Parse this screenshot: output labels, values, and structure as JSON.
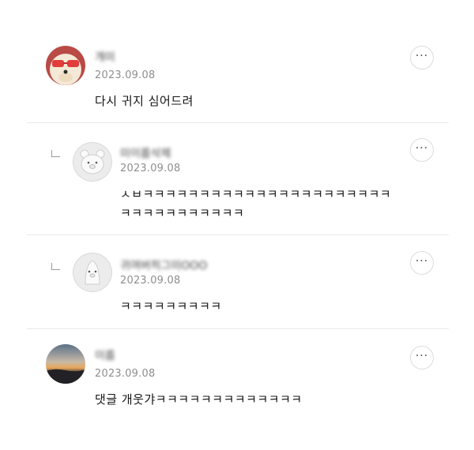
{
  "comments": [
    {
      "name": "개미",
      "date": "2023.09.08",
      "text": "다시 귀지 심어드려",
      "avatar": "puppy-with-sunglasses",
      "reply": false
    },
    {
      "name": "미이름삭제",
      "date": "2023.09.08",
      "text_line1": "ㅅㅂㅋㅋㅋㅋㅋㅋㅋㅋㅋㅋㅋㅋㅋㅋㅋㅋㅋㅋㅋㅋㅋㅋ",
      "text_line2": "ㅋㅋㅋㅋㅋㅋㅋㅋㅋㅋㅋ",
      "avatar": "default-bear-avatar",
      "reply": true
    },
    {
      "name": "귀여버히그미OOO",
      "date": "2023.09.08",
      "text": "ㅋㅋㅋㅋㅋㅋㅋㅋㅋ",
      "avatar": "default-penguin-avatar",
      "reply": true
    },
    {
      "name": "이름",
      "date": "2023.09.08",
      "text": "댓글 개웃갸ㅋㅋㅋㅋㅋㅋㅋㅋㅋㅋㅋㅋㅋ",
      "avatar": "sunset-landscape",
      "reply": false
    }
  ],
  "more_label": "···",
  "icons": {
    "more": "more-options-icon",
    "reply": "reply-indent-icon"
  },
  "colors": {
    "date": "#8e8e8e",
    "divider": "#e9e9e9"
  }
}
